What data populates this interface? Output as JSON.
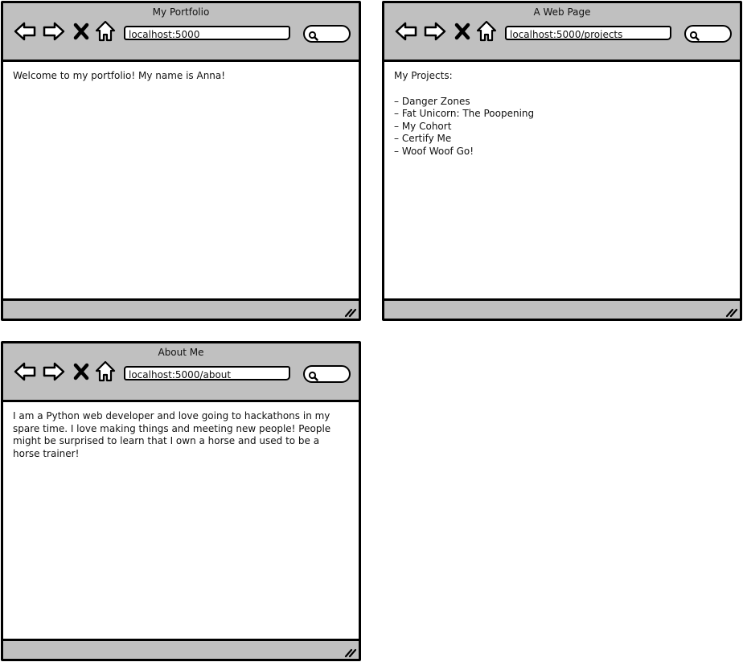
{
  "windows": [
    {
      "title": "My Portfolio",
      "url": "localhost:5000",
      "content_text": "Welcome to my portfolio! My name is Anna!"
    },
    {
      "title": "A Web Page",
      "url": "localhost:5000/projects",
      "heading": "My Projects:",
      "projects": [
        "Danger Zones",
        "Fat Unicorn: The Poopening",
        "My Cohort",
        "Certify Me",
        "Woof Woof Go!"
      ]
    },
    {
      "title": "About Me",
      "url": "localhost:5000/about",
      "content_text": "I am a Python web developer and love going to hackathons in my spare time. I love making things and meeting new people! People might be surprised to learn that I own a horse and used to be a horse trainer!"
    }
  ],
  "icons": {
    "back": "back-arrow-icon",
    "forward": "forward-arrow-icon",
    "stop": "close-icon",
    "home": "home-icon",
    "search": "search-icon",
    "resize": "resize-grip-icon"
  },
  "colors": {
    "chrome": "#c0c0c0",
    "border": "#000000",
    "page": "#ffffff"
  }
}
